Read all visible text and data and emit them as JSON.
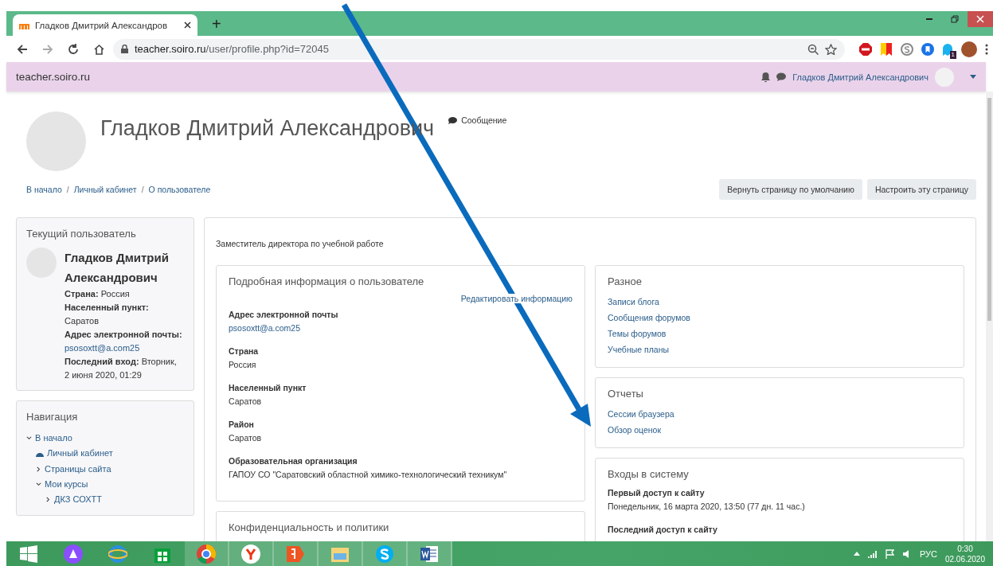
{
  "browser": {
    "tab_title": "Гладков Дмитрий Александров",
    "new_tab": "+",
    "url_host": "teacher.soiro.ru",
    "url_path": "/user/profile.php?id=72045",
    "extension_badge": "1"
  },
  "navbar": {
    "site": "teacher.soiro.ru",
    "user": "Гладков Дмитрий Александрович"
  },
  "header": {
    "name": "Гладков Дмитрий Александрович",
    "message": "Сообщение",
    "separator": "/",
    "breadcrumbs": [
      "В начало",
      "Личный кабинет",
      "О пользователе"
    ],
    "buttons": [
      "Вернуть страницу по умолчанию",
      "Настроить эту страницу"
    ]
  },
  "current_user": {
    "title": "Текущий пользователь",
    "name": "Гладков Дмитрий Александрович",
    "fields": [
      {
        "label": "Страна:",
        "value": "Россия",
        "kind": "text"
      },
      {
        "label": "Населенный пункт:",
        "value": "Саратов",
        "kind": "text"
      },
      {
        "label": "Адрес электронной почты:",
        "value": "psosoxtt@a.com25",
        "kind": "link"
      },
      {
        "label": "Последний вход:",
        "value": "Вторник, 2 июня 2020, 01:29",
        "kind": "text"
      }
    ]
  },
  "navigation": {
    "title": "Навигация",
    "items": [
      {
        "label": "В начало",
        "kind": "branch",
        "expanded": true,
        "children": [
          {
            "label": "Личный кабинет",
            "kind": "dashboard"
          },
          {
            "label": "Страницы сайта",
            "kind": "branch",
            "expanded": false
          },
          {
            "label": "Мои курсы",
            "kind": "branch",
            "expanded": true,
            "children": [
              {
                "label": "ДКЗ СОХТТ",
                "kind": "branch",
                "expanded": false
              }
            ]
          }
        ]
      }
    ]
  },
  "main": {
    "position": "Заместитель директора по учебной работе",
    "details": {
      "title": "Подробная информация о пользователе",
      "edit": "Редактировать информацию",
      "fields": [
        {
          "label": "Адрес электронной почты",
          "value": "psosoxtt@a.com25",
          "kind": "link"
        },
        {
          "label": "Страна",
          "value": "Россия",
          "kind": "text"
        },
        {
          "label": "Населенный пункт",
          "value": "Саратов",
          "kind": "text"
        },
        {
          "label": "Район",
          "value": "Саратов",
          "kind": "text"
        },
        {
          "label": "Образовательная организация",
          "value": "ГАПОУ СО \"Саратовский областной химико-технологический техникум\"",
          "kind": "text"
        }
      ]
    },
    "privacy": {
      "title": "Конфиденциальность и политики"
    },
    "misc": {
      "title": "Разное",
      "links": [
        "Записи блога",
        "Сообщения форумов",
        "Темы форумов",
        "Учебные планы"
      ]
    },
    "reports": {
      "title": "Отчеты",
      "links": [
        "Сессии браузера",
        "Обзор оценок"
      ]
    },
    "logins": {
      "title": "Входы в систему",
      "items": [
        {
          "label": "Первый доступ к сайту",
          "value": "Понедельник, 16 марта 2020, 13:50  (77 дн. 11 час.)"
        },
        {
          "label": "Последний доступ к сайту"
        }
      ]
    }
  },
  "taskbar": {
    "apps": [
      {
        "kind": "start",
        "running": false
      },
      {
        "kind": "alice",
        "running": false
      },
      {
        "kind": "ie",
        "running": false
      },
      {
        "kind": "store",
        "running": false
      },
      {
        "kind": "chrome",
        "running": true
      },
      {
        "kind": "ybrowser",
        "running": true
      },
      {
        "kind": "yandex",
        "running": true
      },
      {
        "kind": "explorer",
        "running": true
      },
      {
        "kind": "skype",
        "running": true
      },
      {
        "kind": "word",
        "running": true
      }
    ],
    "language": "РУС",
    "time": "0:30",
    "date": "02.06.2020"
  }
}
